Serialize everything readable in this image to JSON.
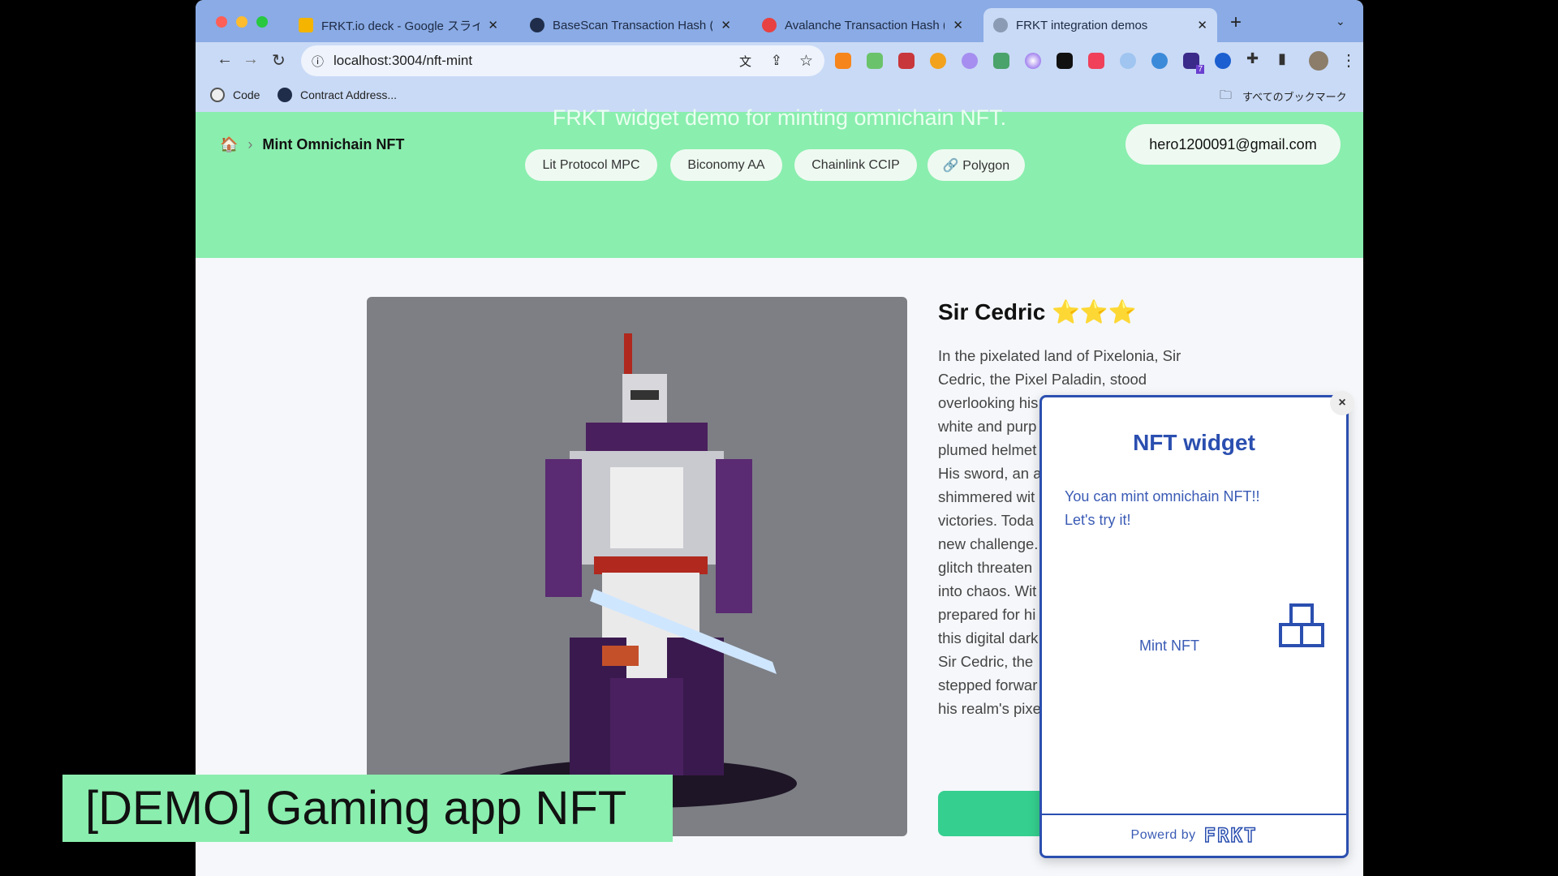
{
  "browser": {
    "tabs": [
      {
        "title": "FRKT.io deck - Google スライド",
        "favicon_color": "#f4b400"
      },
      {
        "title": "BaseScan Transaction Hash (Txhash)",
        "favicon_color": "#1f2d4a"
      },
      {
        "title": "Avalanche Transaction Hash (Txhash)",
        "favicon_color": "#e84142"
      },
      {
        "title": "FRKT integration demos",
        "favicon_color": "#8a9bb3",
        "active": true
      }
    ],
    "url": "localhost:3004/nft-mint",
    "bookmarks": [
      "Code",
      "Contract Address..."
    ],
    "all_bookmarks": "すべてのブックマーク",
    "extension_badge": "7"
  },
  "header": {
    "title": "FRKT widget demo for minting omnichain NFT.",
    "breadcrumb": "Mint Omnichain NFT",
    "pills": [
      "Lit Protocol MPC",
      "Biconomy AA",
      "Chainlink CCIP",
      "🔗 Polygon"
    ],
    "email": "hero1200091@gmail.com"
  },
  "nft": {
    "name": "Sir Cedric",
    "stars": "⭐⭐⭐",
    "description_lines": [
      "In the pixelated land of Pixelonia, Sir",
      "Cedric, the Pixel Paladin, stood",
      "overlooking his",
      "white and purp",
      "plumed helmet",
      "His sword, an a",
      "shimmered wit",
      "victories. Toda",
      "new challenge.",
      "glitch threaten",
      "into chaos. Wit",
      "prepared for hi",
      "this digital dark",
      "Sir Cedric, the",
      "stepped forwar",
      "his realm's pixe"
    ]
  },
  "widget": {
    "close": "×",
    "title": "NFT widget",
    "message_line1": "You can mint omnichain NFT!!",
    "message_line2": "Let's try it!",
    "mint_label": "Mint NFT",
    "powered_by": "Powerd by",
    "brand": "FRKT"
  },
  "caption": "[DEMO] Gaming app NFT"
}
